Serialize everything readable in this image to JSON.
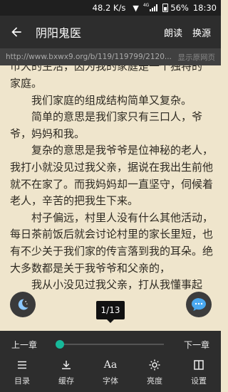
{
  "status_bar": {
    "speed": "48.2 K/s",
    "network": "4G",
    "battery": "56%",
    "time": "18:30"
  },
  "app_bar": {
    "title": "阴阳鬼医",
    "read_aloud": "朗读",
    "change_source": "换源"
  },
  "url_bar": {
    "url": "http://www.bxwx9.org/b/119/119799/2120...",
    "show_source": "显示原网页"
  },
  "content": {
    "top_partial": "市大的生活，因为我的家庭是一个独特的",
    "paragraphs": [
      {
        "text": "家庭。",
        "indent": false
      },
      {
        "text": "我们家庭的组成结构简单又复杂。",
        "indent": true
      },
      {
        "text": "简单的意思是我们家只有三口人，爷爷，妈妈和我。",
        "indent": true
      },
      {
        "text": "复杂的意思是我爷爷是位神秘的老人，我打小就没见过我父亲，据说在我出生前他就不在家了。而我妈妈却一直坚守，伺候着老人，辛苦的把我生下来。",
        "indent": true
      },
      {
        "text": "村子偏远，村里人没有什么其他活动，每日茶前饭后就会讨论村里的家长里短，也有不少关于我们家的传言落到我的耳朵。绝大多数都是关于我爷爷和父亲的，",
        "indent": true
      },
      {
        "text": "我从小没见过我父亲，打从我懂事起",
        "indent": true
      }
    ]
  },
  "page_indicator": "1/13",
  "bottom_panel": {
    "prev_chapter": "上一章",
    "next_chapter": "下一章",
    "progress": 0.0,
    "tools": [
      {
        "icon": "list-icon",
        "label": "目录"
      },
      {
        "icon": "download-icon",
        "label": "缓存"
      },
      {
        "icon": "font-icon",
        "label": "字体"
      },
      {
        "icon": "brightness-icon",
        "label": "亮度"
      },
      {
        "icon": "settings-icon",
        "label": "设置"
      }
    ]
  },
  "colors": {
    "page_background": "#efe5cc",
    "bar_background": "#2d2d2d",
    "accent": "#17b99a"
  }
}
